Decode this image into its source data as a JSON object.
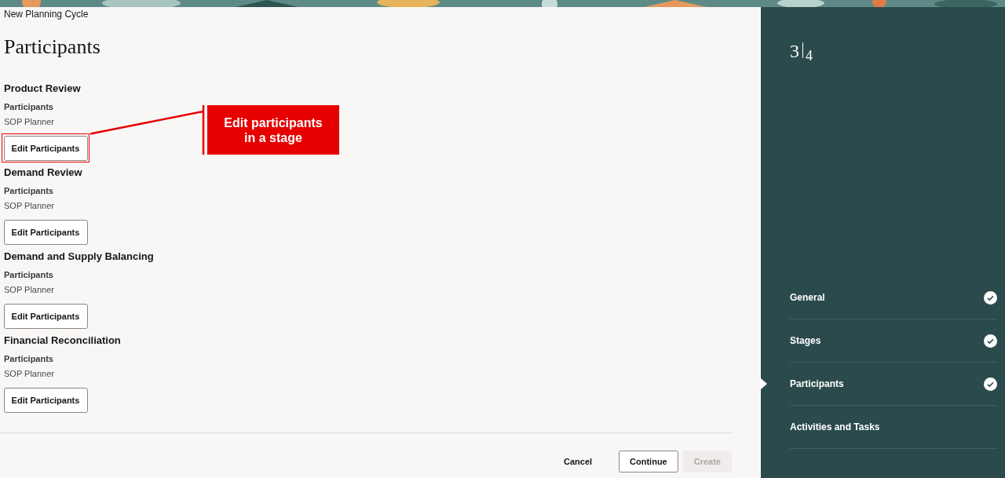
{
  "header": {
    "title": "New Planning Cycle"
  },
  "page_title": "Participants",
  "stages": [
    {
      "name": "Product Review",
      "label": "Participants",
      "value": "SOP Planner",
      "button": "Edit Participants",
      "highlighted": true
    },
    {
      "name": "Demand Review",
      "label": "Participants",
      "value": "SOP Planner",
      "button": "Edit Participants",
      "highlighted": false
    },
    {
      "name": "Demand and Supply Balancing",
      "label": "Participants",
      "value": "SOP Planner",
      "button": "Edit Participants",
      "highlighted": false
    },
    {
      "name": "Financial Reconciliation",
      "label": "Participants",
      "value": "SOP Planner",
      "button": "Edit Participants",
      "highlighted": false
    }
  ],
  "callout": {
    "text": "Edit participants in a stage"
  },
  "footer": {
    "buttons": [
      {
        "label": "Cancel",
        "kind": "text",
        "disabled": false
      },
      {
        "label": "Continue",
        "kind": "outline",
        "disabled": false
      },
      {
        "label": "Create",
        "kind": "solid",
        "disabled": true
      }
    ]
  },
  "train": {
    "current": "3",
    "total": "4",
    "steps": [
      {
        "label": "General",
        "completed": true,
        "selected": false
      },
      {
        "label": "Stages",
        "completed": true,
        "selected": false
      },
      {
        "label": "Participants",
        "completed": true,
        "selected": true
      },
      {
        "label": "Activities and Tasks",
        "completed": false,
        "selected": false
      }
    ]
  }
}
